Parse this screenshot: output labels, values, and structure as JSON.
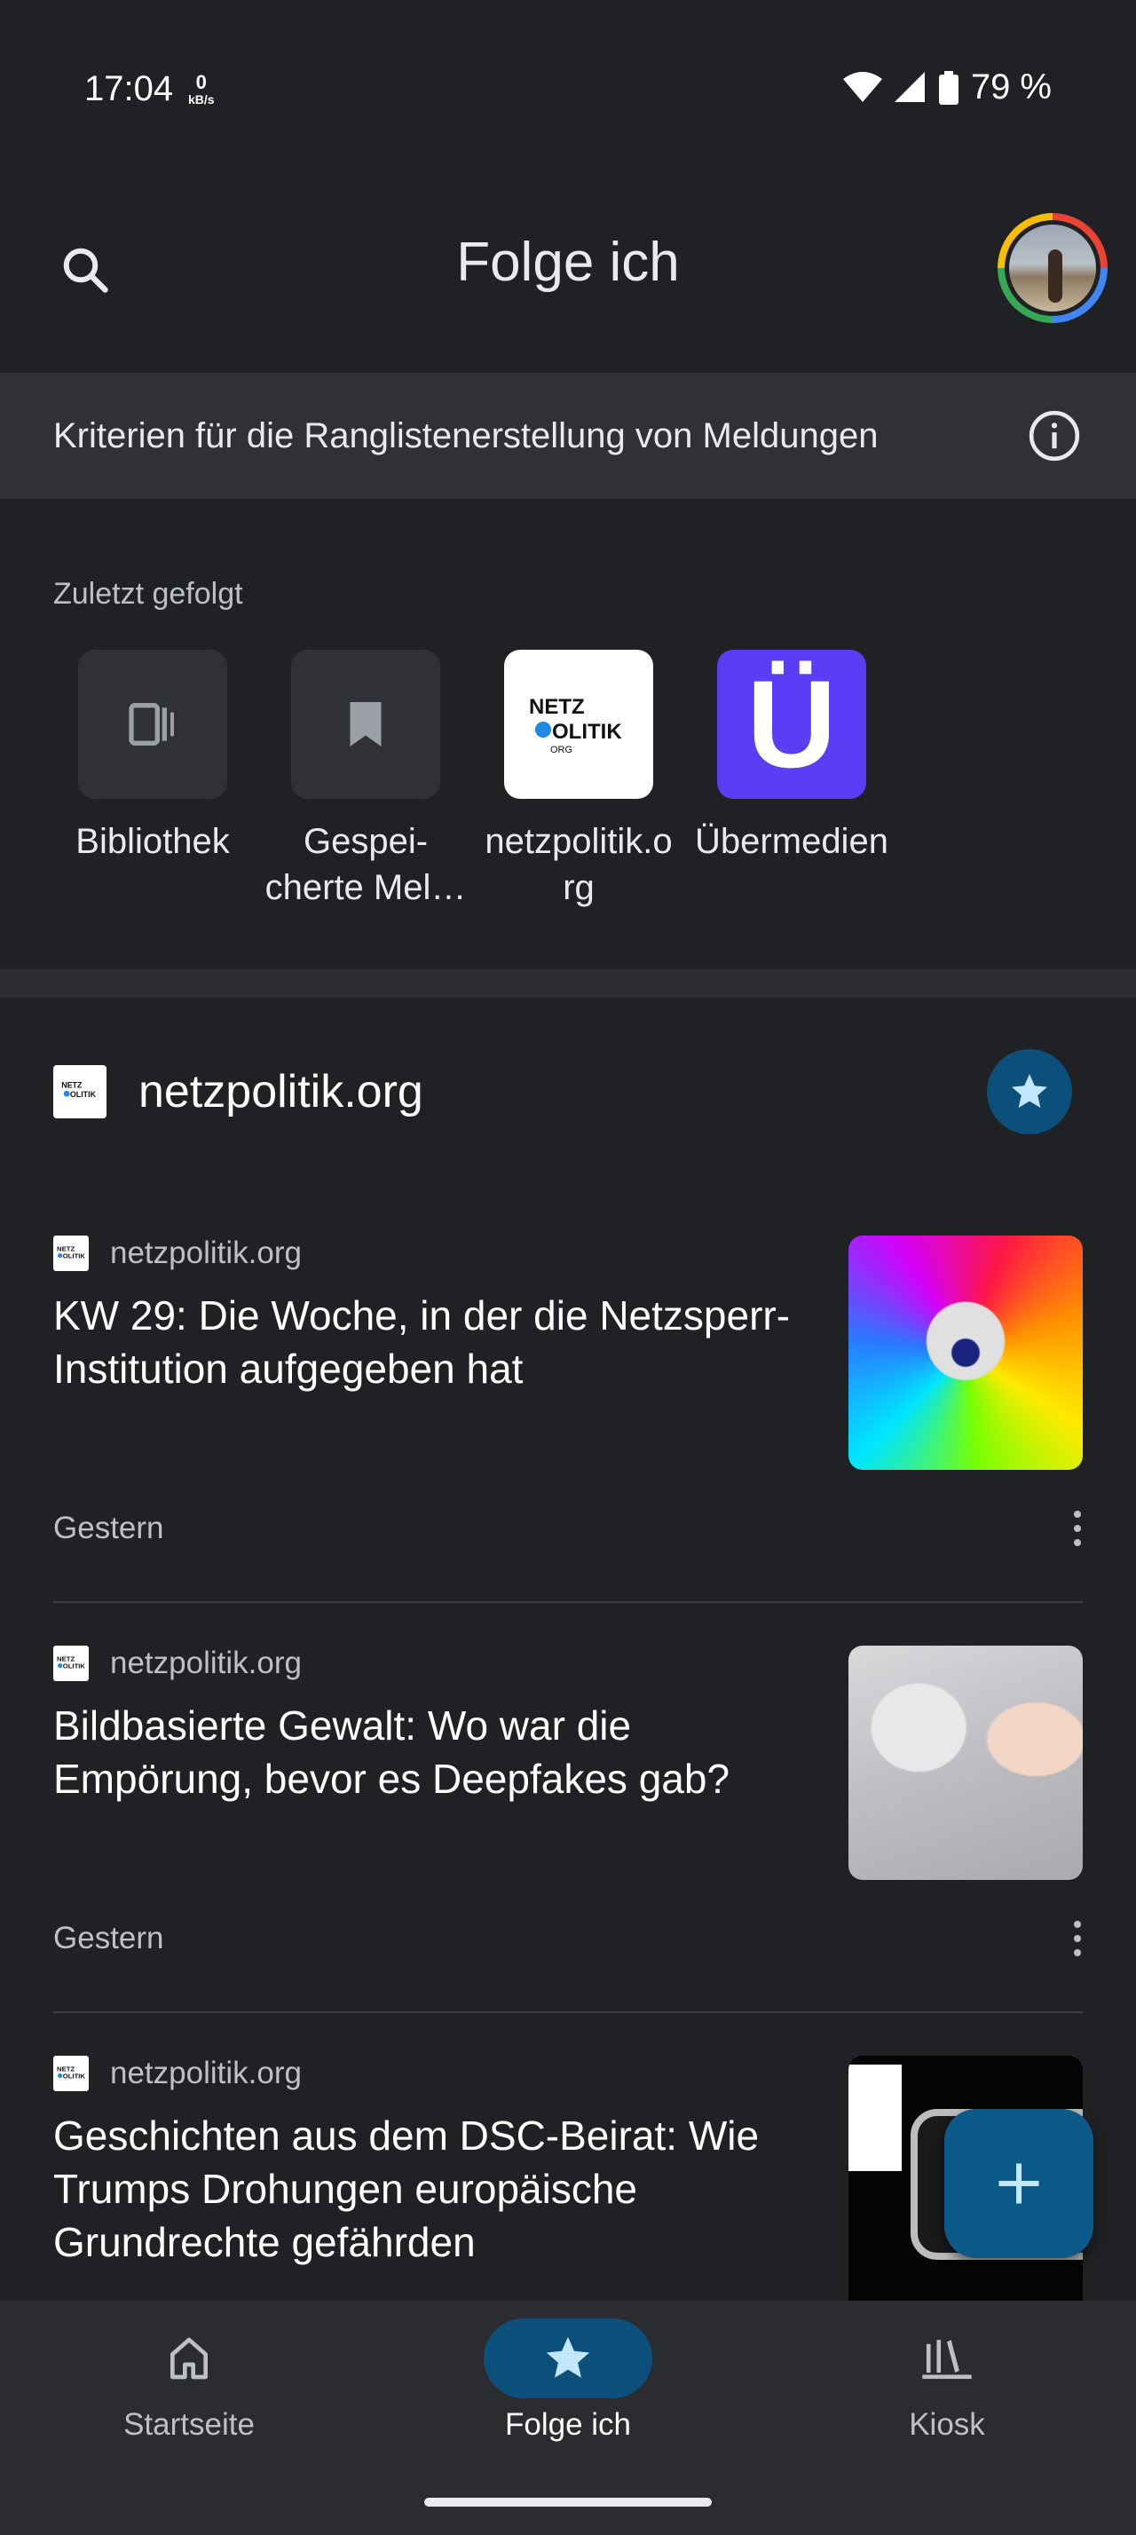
{
  "status_bar": {
    "time": "17:04",
    "net_speed_value": "0",
    "net_speed_unit": "kB/s",
    "battery": "79 %"
  },
  "app_bar": {
    "title": "Folge ich",
    "search_icon": "search-icon",
    "avatar": "account-avatar"
  },
  "criteria_banner": {
    "text": "Kriterien für die Ranglistenerstellung von Meldungen",
    "icon": "info-icon"
  },
  "recent": {
    "label": "Zuletzt gefolgt",
    "items": [
      {
        "line1": "Bibliothek",
        "line2": "",
        "icon": "library-icon"
      },
      {
        "line1": "Gespei-",
        "line2": "cherte Mel…",
        "icon": "bookmark-icon"
      },
      {
        "line1": "netzpolitik.o",
        "line2": "rg",
        "icon": "netzpolitik-logo"
      },
      {
        "line1": "Übermedien",
        "line2": "",
        "icon": "uebermedien-logo",
        "logo_letter": "Ü"
      }
    ]
  },
  "source": {
    "title": "netzpolitik.org",
    "logo_text": "NETZ POLITIK ORG",
    "follow_icon": "star-icon"
  },
  "articles": [
    {
      "source": "netzpolitik.org",
      "title": "KW 29: Die Woche, in der die Netzsperr-Institution aufgegeben hat",
      "date": "Gestern"
    },
    {
      "source": "netzpolitik.org",
      "title": "Bildbasierte Gewalt: Wo war die Empörung, bevor es Deepfakes gab?",
      "date": "Gestern"
    },
    {
      "source": "netzpolitik.org",
      "title": "Geschichten aus dem DSC-Beirat: Wie Trumps Drohungen europäische Grundrechte gefährden",
      "date": ""
    }
  ],
  "fab": {
    "icon": "plus-icon"
  },
  "bottom_nav": {
    "items": [
      {
        "label": "Startseite",
        "icon": "home-icon"
      },
      {
        "label": "Folge ich",
        "icon": "star-icon",
        "active": true
      },
      {
        "label": "Kiosk",
        "icon": "newsstand-icon"
      }
    ]
  },
  "colors": {
    "background": "#202124",
    "banner": "#303134",
    "accent": "#0b4f7a",
    "uebermedien": "#5b3df5"
  }
}
